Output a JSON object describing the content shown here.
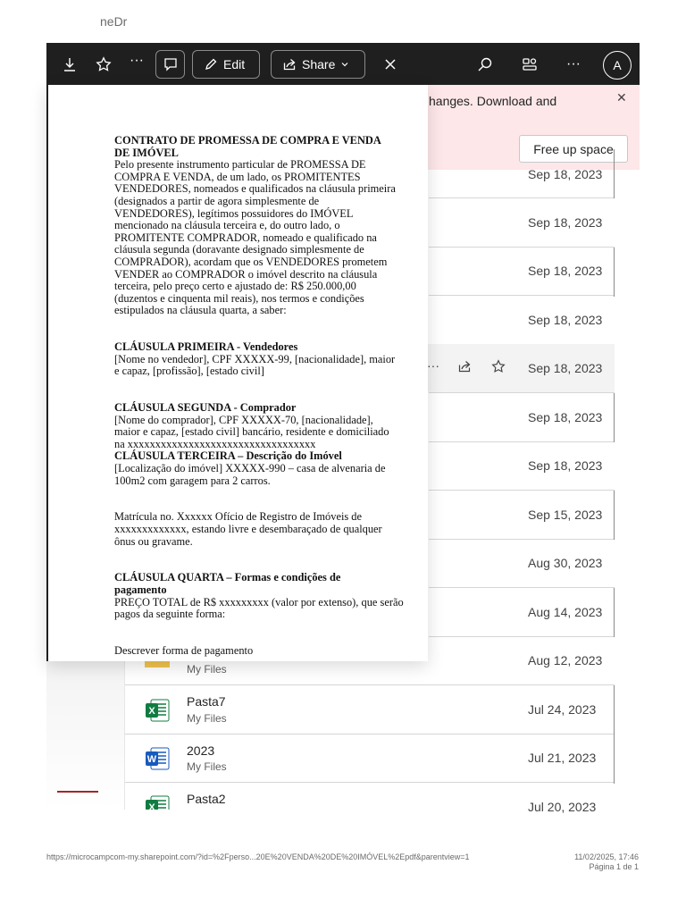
{
  "toolbar": {
    "ghost_text": "neDr",
    "edit_label": "Edit",
    "share_label": "Share",
    "avatar_initial": "A"
  },
  "banner": {
    "text": "hanges. Download and",
    "free_up_label": "Free up space"
  },
  "files": {
    "dates": [
      "Sep 18, 2023",
      "Sep 18, 2023",
      "Sep 18, 2023",
      "Sep 18, 2023",
      "Sep 18, 2023",
      "Sep 18, 2023",
      "Sep 18, 2023",
      "Sep 15, 2023",
      "Aug 30, 2023",
      "Aug 14, 2023",
      "Aug 12, 2023",
      "Jul 24, 2023",
      "Jul 21, 2023",
      "Jul 20, 2023"
    ],
    "rows": [
      {
        "name": "",
        "location": "My Files",
        "icon": "folder-icon"
      },
      {
        "name": "Pasta7",
        "location": "My Files",
        "icon": "excel-icon"
      },
      {
        "name": "2023",
        "location": "My Files",
        "icon": "word-icon"
      },
      {
        "name": "Pasta2",
        "location": "",
        "icon": "excel-icon"
      }
    ]
  },
  "document": {
    "title_lines": [
      "CONTRATO DE PROMESSA DE COMPRA E VENDA",
      "DE IMÓVEL"
    ],
    "intro_lines": [
      "Pelo presente instrumento particular de PROMESSA DE",
      "COMPRA E VENDA, de um lado, os PROMITENTES",
      "VENDEDORES, nomeados e qualificados na cláusula primeira",
      "(designados a partir de agora simplesmente de",
      "VENDEDORES), legítimos possuidores do IMÓVEL",
      "mencionado na cláusula terceira e, do outro lado, o",
      "PROMITENTE COMPRADOR, nomeado e qualificado na",
      "cláusula segunda (doravante designado simplesmente de",
      "COMPRADOR), acordam que os VENDEDORES prometem",
      "VENDER ao COMPRADOR o imóvel descrito na cláusula",
      "terceira, pelo preço certo e ajustado de: R$ 250.000,00",
      "(duzentos e cinquenta mil reais), nos termos e condições",
      "estipulados na cláusula quarta, a saber:"
    ],
    "c1_title": "CLÁUSULA PRIMEIRA - Vendedores",
    "c1_lines": [
      "[Nome no vendedor], CPF XXXXX-99, [nacionalidade], maior",
      "e capaz, [profissão], [estado civil]"
    ],
    "c2_title": "CLÁUSULA SEGUNDA - Comprador",
    "c2_lines": [
      "[Nome do comprador], CPF XXXXX-70, [nacionalidade],",
      "maior e capaz, [estado civil] bancário, residente e domiciliado",
      "na xxxxxxxxxxxxxxxxxxxxxxxxxxxxxxxxxx"
    ],
    "c3_title": "CLÁUSULA TERCEIRA – Descrição do Imóvel",
    "c3_lines": [
      "[Localização do imóvel] XXXXX-990 – casa de alvenaria de",
      "100m2 com garagem para 2 carros."
    ],
    "matricula_lines": [
      "Matrícula no. Xxxxxx  Ofício de Registro de Imóveis de",
      "xxxxxxxxxxxxx, estando livre e desembaraçado de qualquer",
      "ônus ou gravame."
    ],
    "c4_title_lines": [
      "CLÁUSULA QUARTA – Formas e condições de",
      "pagamento"
    ],
    "c4_lines": [
      "PREÇO TOTAL de R$ xxxxxxxxx (valor por extenso), que serão",
      "pagos da seguinte forma:"
    ],
    "payment_line": "Descrever forma de pagamento"
  },
  "footer": {
    "url": "https://microcampcom-my.sharepoint.com/?id=%2Fperso...20E%20VENDA%20DE%20IMÓVEL%2Epdf&parentview=1",
    "datetime": "11/02/2025, 17:46",
    "page": "Página 1 de 1"
  },
  "colors": {
    "toolbar_bg": "#1f1f1f",
    "banner_bg": "#fde7e9",
    "excel_green": "#107c41",
    "word_blue": "#185abd",
    "folder_yellow": "#e8a93a"
  }
}
